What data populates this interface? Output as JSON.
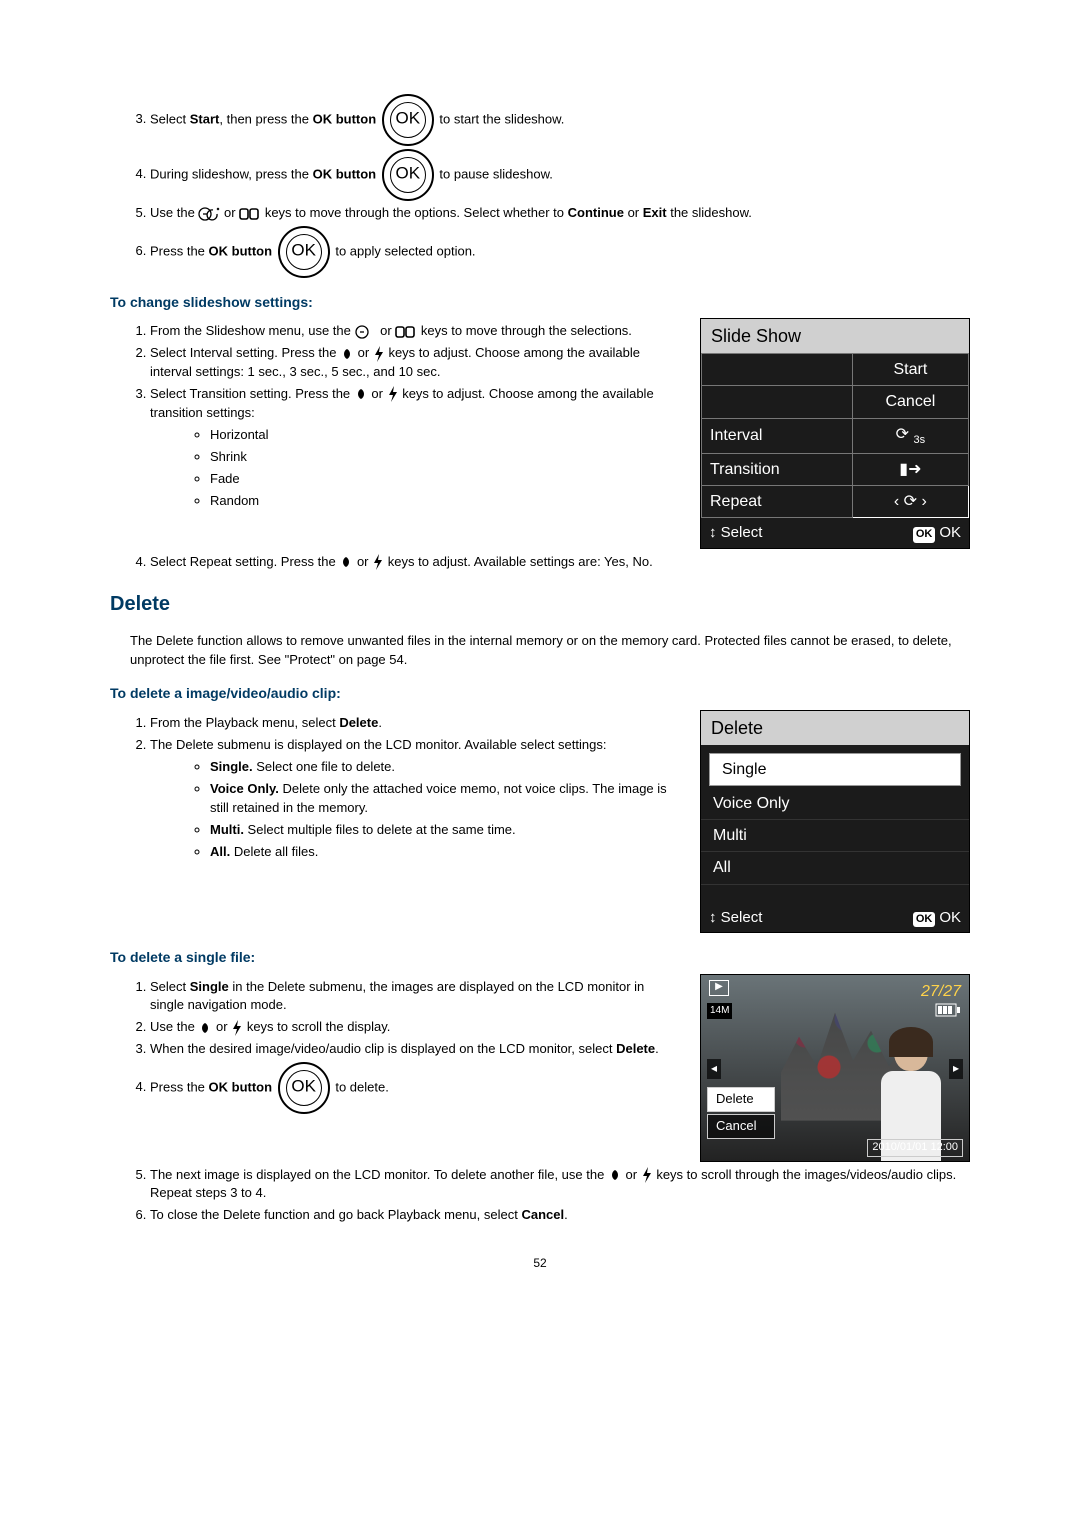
{
  "steps_a": {
    "s3_a": "Select ",
    "s3_b": "Start",
    "s3_c": ", then press the ",
    "s3_d": "OK button",
    "s3_e": " to start the slideshow.",
    "s4_a": "During slideshow, press the ",
    "s4_b": "OK button",
    "s4_c": " to pause slideshow.",
    "s5_a": "Use the ",
    "s5_b": " or ",
    "s5_c": " keys to move through the options. Select whether to ",
    "s5_d": "Continue",
    "s5_e": " or ",
    "s5_f": "Exit",
    "s5_g": " the slideshow.",
    "s6_a": "Press the ",
    "s6_b": "OK button",
    "s6_c": " to apply selected option."
  },
  "heading_change": "To change slideshow settings:",
  "change": {
    "s1_a": "From the Slideshow menu, use the ",
    "s1_b": " or ",
    "s1_c": " keys to move through the selections.",
    "s2_a": "Select Interval setting. Press the ",
    "s2_b": " or ",
    "s2_c": " keys to adjust. Choose among the available interval settings: 1 sec., 3 sec., 5 sec., and 10 sec.",
    "s3_a": "Select Transition setting. Press the ",
    "s3_b": " or ",
    "s3_c": " keys to adjust. Choose among the available transition settings:",
    "bullets": [
      "Horizontal",
      "Shrink",
      "Fade",
      "Random"
    ],
    "s4_a": "Select Repeat setting. Press the ",
    "s4_b": " or ",
    "s4_c": " keys to adjust. Available settings are: Yes, No."
  },
  "slide_lcd": {
    "title": "Slide Show",
    "rows": [
      {
        "l": "",
        "r": "Start"
      },
      {
        "l": "",
        "r": "Cancel"
      },
      {
        "l": "Interval",
        "r": "3s"
      },
      {
        "l": "Transition",
        "r": "▮➜"
      },
      {
        "l": "Repeat",
        "r": "‹  ⟳  ›"
      }
    ],
    "footer_l": "↕  Select",
    "footer_r": "OK"
  },
  "h_delete": "Delete",
  "delete_intro": "The Delete function allows to remove unwanted files in the internal memory or on the memory card. Protected files cannot be erased, to delete, unprotect the file first. See \"Protect\" on page 54.",
  "h_del1": "To delete a image/video/audio clip:",
  "del1": {
    "s1_a": "From the Playback menu, select ",
    "s1_b": "Delete",
    "s1_c": ".",
    "s2": "The Delete submenu is displayed on the LCD monitor. Available select settings:",
    "b1a": "Single.",
    "b1b": " Select one file to delete.",
    "b2a": "Voice Only.",
    "b2b": " Delete only the attached voice memo, not voice clips. The image is still retained in the memory.",
    "b3a": "Multi.",
    "b3b": " Select multiple files to delete at the same time.",
    "b4a": "All.",
    "b4b": " Delete all files."
  },
  "del_lcd": {
    "title": "Delete",
    "items": [
      "Single",
      "Voice Only",
      "Multi",
      "All"
    ],
    "footer_l": "↕  Select",
    "footer_r": "OK"
  },
  "h_del2": "To delete a single file:",
  "del2": {
    "s1_a": "Select ",
    "s1_b": "Single",
    "s1_c": " in the Delete submenu, the images are displayed on the LCD monitor in single navigation mode.",
    "s2_a": "Use the ",
    "s2_b": " or ",
    "s2_c": " keys to scroll the display.",
    "s3_a": "When the desired image/video/audio clip is displayed on the LCD monitor, select ",
    "s3_b": "Delete",
    "s3_c": ".",
    "s4_a": "Press the ",
    "s4_b": "OK button",
    "s4_c": " to delete.",
    "s5_a": "The next image is displayed on the LCD monitor. To delete another file, use the ",
    "s5_b": " or ",
    "s5_c": " keys to scroll through the images/videos/audio clips. Repeat steps 3 to 4.",
    "s6_a": "To close the Delete function and go back Playback menu, select ",
    "s6_b": "Cancel",
    "s6_c": "."
  },
  "photo": {
    "counter": "27/27",
    "res": "14M",
    "menu_delete": "Delete",
    "menu_cancel": "Cancel",
    "timestamp": "2010/01/01  12:00"
  },
  "pagenum": "52"
}
